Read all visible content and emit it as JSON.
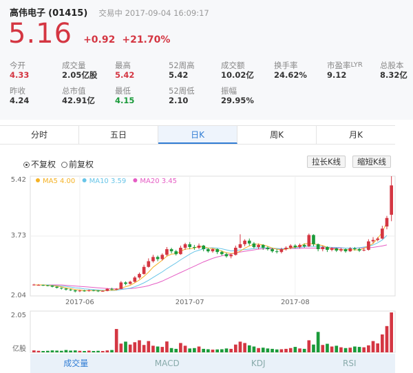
{
  "header": {
    "name": "高伟电子",
    "code": "(01415)",
    "status": "交易中 2017-09-04 16:09:17",
    "price": "5.16",
    "change": "+0.92",
    "change_pct": "+21.70%"
  },
  "stats": {
    "open": {
      "label": "今开",
      "value": "4.33"
    },
    "volume": {
      "label": "成交量",
      "value": "2.05亿股"
    },
    "high": {
      "label": "最高",
      "value": "5.42"
    },
    "high52": {
      "label": "52周高",
      "value": "5.42"
    },
    "turnover": {
      "label": "成交额",
      "value": "10.02亿"
    },
    "turnover_rate": {
      "label": "换手率",
      "value": "24.62%"
    },
    "pe": {
      "label": "市盈率",
      "label_sup": "LYR",
      "value": "9.12"
    },
    "total_shares": {
      "label": "总股本",
      "value": "8.32亿"
    },
    "prev_close": {
      "label": "昨收",
      "value": "4.24"
    },
    "market_cap": {
      "label": "总市值",
      "value": "42.91亿"
    },
    "low": {
      "label": "最低",
      "value": "4.15"
    },
    "low52": {
      "label": "52周低",
      "value": "2.10"
    },
    "amplitude": {
      "label": "振幅",
      "value": "29.95%"
    }
  },
  "tabs": [
    "分时",
    "五日",
    "日K",
    "周K",
    "月K"
  ],
  "options": {
    "no_adjust": "不复权",
    "forward_adjust": "前复权",
    "stretch": "拉长K线",
    "shrink": "缩短K线"
  },
  "bottom_tabs": [
    "成交量",
    "MACD",
    "KDJ",
    "RSI"
  ],
  "colors": {
    "up": "#d43642",
    "down": "#1a9a3a",
    "ma5": "#f5b225",
    "ma10": "#68c5e8",
    "ma20": "#e55cc4",
    "accent": "#2f7cd4"
  },
  "chart_data": {
    "type": "candlestick",
    "legend": [
      {
        "name": "MA5",
        "value": "4.00"
      },
      {
        "name": "MA10",
        "value": "3.59"
      },
      {
        "name": "MA20",
        "value": "3.45"
      }
    ],
    "y_ticks": [
      "5.42",
      "3.73",
      "2.04"
    ],
    "ylim": [
      2.04,
      5.42
    ],
    "x_ticks": [
      "2017-06",
      "2017-07",
      "2017-08"
    ],
    "x_tick_index": [
      10,
      34,
      57
    ],
    "volume_ticks": [
      "2.05",
      "亿股"
    ],
    "volume_max": 2.05,
    "candles": [
      [
        2.35,
        2.36,
        2.38,
        2.33,
        0.1
      ],
      [
        2.35,
        2.35,
        2.37,
        2.33,
        0.08
      ],
      [
        2.35,
        2.34,
        2.36,
        2.32,
        0.07
      ],
      [
        2.34,
        2.33,
        2.35,
        2.31,
        0.08
      ],
      [
        2.33,
        2.3,
        2.34,
        2.28,
        0.1
      ],
      [
        2.3,
        2.27,
        2.31,
        2.25,
        0.09
      ],
      [
        2.27,
        2.25,
        2.28,
        2.22,
        0.08
      ],
      [
        2.25,
        2.22,
        2.26,
        2.19,
        0.12
      ],
      [
        2.22,
        2.2,
        2.24,
        2.18,
        0.09
      ],
      [
        2.2,
        2.17,
        2.21,
        2.14,
        0.1
      ],
      [
        2.17,
        2.19,
        2.21,
        2.15,
        0.08
      ],
      [
        2.19,
        2.18,
        2.21,
        2.16,
        0.07
      ],
      [
        2.18,
        2.2,
        2.22,
        2.16,
        0.09
      ],
      [
        2.2,
        2.19,
        2.21,
        2.17,
        0.07
      ],
      [
        2.19,
        2.17,
        2.2,
        2.15,
        0.08
      ],
      [
        2.17,
        2.18,
        2.2,
        2.16,
        0.07
      ],
      [
        2.18,
        2.24,
        2.26,
        2.17,
        0.1
      ],
      [
        2.24,
        2.22,
        2.27,
        2.2,
        0.12
      ],
      [
        2.22,
        2.24,
        2.26,
        2.2,
        1.2
      ],
      [
        2.24,
        2.42,
        2.46,
        2.23,
        0.45
      ],
      [
        2.42,
        2.38,
        2.45,
        2.34,
        0.55
      ],
      [
        2.38,
        2.44,
        2.47,
        2.36,
        0.4
      ],
      [
        2.44,
        2.56,
        2.6,
        2.42,
        0.52
      ],
      [
        2.56,
        2.66,
        2.7,
        2.52,
        0.62
      ],
      [
        2.66,
        2.86,
        2.92,
        2.64,
        0.38
      ],
      [
        2.86,
        3.02,
        3.1,
        2.84,
        0.58
      ],
      [
        3.02,
        3.14,
        3.2,
        2.98,
        0.34
      ],
      [
        3.14,
        3.08,
        3.18,
        3.02,
        0.3
      ],
      [
        3.08,
        3.2,
        3.24,
        3.04,
        0.28
      ],
      [
        3.2,
        3.36,
        3.42,
        3.16,
        0.56
      ],
      [
        3.36,
        3.3,
        3.4,
        3.24,
        0.22
      ],
      [
        3.3,
        3.22,
        3.34,
        3.18,
        0.18
      ],
      [
        3.22,
        3.4,
        3.46,
        3.2,
        0.48
      ],
      [
        3.4,
        3.5,
        3.54,
        3.34,
        0.34
      ],
      [
        3.5,
        3.42,
        3.56,
        3.36,
        0.2
      ],
      [
        3.42,
        3.4,
        3.48,
        3.34,
        0.22
      ],
      [
        3.4,
        3.46,
        3.52,
        3.36,
        0.3
      ],
      [
        3.46,
        3.36,
        3.48,
        3.3,
        0.18
      ],
      [
        3.36,
        3.3,
        3.4,
        3.26,
        0.16
      ],
      [
        3.3,
        3.36,
        3.38,
        3.26,
        0.14
      ],
      [
        3.36,
        3.28,
        3.38,
        3.22,
        0.15
      ],
      [
        3.28,
        3.22,
        3.32,
        3.18,
        0.16
      ],
      [
        3.22,
        3.16,
        3.26,
        3.12,
        0.2
      ],
      [
        3.16,
        3.2,
        3.24,
        3.1,
        0.18
      ],
      [
        3.2,
        3.4,
        3.46,
        3.18,
        0.4
      ],
      [
        3.4,
        3.5,
        3.78,
        3.38,
        0.55
      ],
      [
        3.5,
        3.6,
        3.64,
        3.44,
        0.48
      ],
      [
        3.6,
        3.52,
        3.66,
        3.46,
        0.36
      ],
      [
        3.52,
        3.42,
        3.56,
        3.38,
        0.3
      ],
      [
        3.42,
        3.48,
        3.52,
        3.36,
        0.22
      ],
      [
        3.48,
        3.4,
        3.5,
        3.34,
        0.24
      ],
      [
        3.4,
        3.36,
        3.44,
        3.32,
        0.2
      ],
      [
        3.36,
        3.3,
        3.4,
        3.26,
        0.18
      ],
      [
        3.3,
        3.28,
        3.36,
        3.24,
        0.15
      ],
      [
        3.28,
        3.36,
        3.4,
        3.24,
        0.16
      ],
      [
        3.36,
        3.4,
        3.44,
        3.32,
        0.18
      ],
      [
        3.4,
        3.46,
        3.5,
        3.36,
        0.22
      ],
      [
        3.46,
        3.42,
        3.5,
        3.38,
        0.28
      ],
      [
        3.42,
        3.48,
        3.52,
        3.38,
        0.2
      ],
      [
        3.48,
        3.44,
        3.52,
        3.4,
        0.18
      ],
      [
        3.44,
        3.76,
        3.8,
        3.42,
        0.62
      ],
      [
        3.76,
        3.5,
        3.78,
        3.44,
        0.4
      ],
      [
        3.5,
        3.36,
        3.52,
        3.3,
        1.05
      ],
      [
        3.36,
        3.42,
        3.46,
        3.3,
        0.38
      ],
      [
        3.42,
        3.34,
        3.44,
        3.28,
        0.44
      ],
      [
        3.34,
        3.38,
        3.42,
        3.3,
        0.3
      ],
      [
        3.38,
        3.32,
        3.4,
        3.28,
        0.34
      ],
      [
        3.32,
        3.36,
        3.4,
        3.28,
        0.26
      ],
      [
        3.36,
        3.3,
        3.38,
        3.26,
        0.22
      ],
      [
        3.3,
        3.38,
        3.42,
        3.28,
        0.24
      ],
      [
        3.38,
        3.36,
        3.42,
        3.32,
        0.3
      ],
      [
        3.36,
        3.32,
        3.4,
        3.28,
        0.28
      ],
      [
        3.32,
        3.34,
        3.38,
        3.3,
        0.26
      ],
      [
        3.34,
        3.58,
        3.64,
        3.32,
        0.36
      ],
      [
        3.58,
        3.62,
        3.7,
        3.52,
        0.58
      ],
      [
        3.62,
        3.66,
        3.7,
        3.58,
        0.46
      ],
      [
        3.66,
        3.94,
        4.02,
        3.64,
        0.92
      ],
      [
        4.0,
        4.24,
        4.3,
        3.92,
        1.35
      ],
      [
        4.33,
        5.16,
        5.42,
        4.15,
        2.05
      ]
    ],
    "ma5": [
      2.35,
      2.35,
      2.35,
      2.34,
      2.33,
      2.32,
      2.3,
      2.27,
      2.25,
      2.22,
      2.21,
      2.19,
      2.19,
      2.19,
      2.19,
      2.18,
      2.2,
      2.2,
      2.21,
      2.26,
      2.3,
      2.34,
      2.41,
      2.49,
      2.59,
      2.71,
      2.85,
      2.95,
      3.05,
      3.16,
      3.22,
      3.23,
      3.3,
      3.36,
      3.37,
      3.39,
      3.44,
      3.43,
      3.39,
      3.38,
      3.35,
      3.3,
      3.26,
      3.24,
      3.25,
      3.3,
      3.39,
      3.45,
      3.5,
      3.5,
      3.48,
      3.44,
      3.39,
      3.36,
      3.34,
      3.36,
      3.39,
      3.42,
      3.44,
      3.51,
      3.52,
      3.5,
      3.49,
      3.46,
      3.41,
      3.37,
      3.36,
      3.34,
      3.35,
      3.35,
      3.34,
      3.34,
      3.38,
      3.45,
      3.52,
      3.66,
      3.84,
      4.12
    ],
    "ma10": [
      2.35,
      2.35,
      2.35,
      2.35,
      2.34,
      2.33,
      2.32,
      2.31,
      2.29,
      2.27,
      2.26,
      2.24,
      2.23,
      2.22,
      2.21,
      2.2,
      2.2,
      2.19,
      2.2,
      2.22,
      2.24,
      2.26,
      2.3,
      2.35,
      2.41,
      2.48,
      2.56,
      2.64,
      2.72,
      2.81,
      2.89,
      2.97,
      3.06,
      3.14,
      3.22,
      3.29,
      3.33,
      3.37,
      3.39,
      3.4,
      3.39,
      3.37,
      3.34,
      3.31,
      3.32,
      3.34,
      3.35,
      3.36,
      3.38,
      3.4,
      3.4,
      3.4,
      3.39,
      3.38,
      3.37,
      3.38,
      3.39,
      3.4,
      3.41,
      3.43,
      3.44,
      3.44,
      3.44,
      3.43,
      3.42,
      3.41,
      3.41,
      3.4,
      3.39,
      3.39,
      3.39,
      3.4,
      3.42,
      3.44,
      3.48,
      3.54,
      3.62,
      3.75
    ],
    "ma20": [
      2.35,
      2.35,
      2.35,
      2.35,
      2.35,
      2.35,
      2.35,
      2.34,
      2.33,
      2.32,
      2.31,
      2.3,
      2.29,
      2.28,
      2.27,
      2.26,
      2.25,
      2.24,
      2.24,
      2.24,
      2.24,
      2.25,
      2.26,
      2.28,
      2.3,
      2.33,
      2.37,
      2.41,
      2.46,
      2.52,
      2.58,
      2.64,
      2.7,
      2.76,
      2.82,
      2.88,
      2.94,
      3.0,
      3.05,
      3.1,
      3.14,
      3.17,
      3.2,
      3.22,
      3.25,
      3.28,
      3.3,
      3.32,
      3.34,
      3.36,
      3.37,
      3.37,
      3.37,
      3.37,
      3.37,
      3.37,
      3.38,
      3.38,
      3.38,
      3.39,
      3.39,
      3.39,
      3.39,
      3.39,
      3.39,
      3.39,
      3.39,
      3.39,
      3.39,
      3.39,
      3.39,
      3.39,
      3.4,
      3.4,
      3.41,
      3.43,
      3.45,
      3.48
    ]
  }
}
